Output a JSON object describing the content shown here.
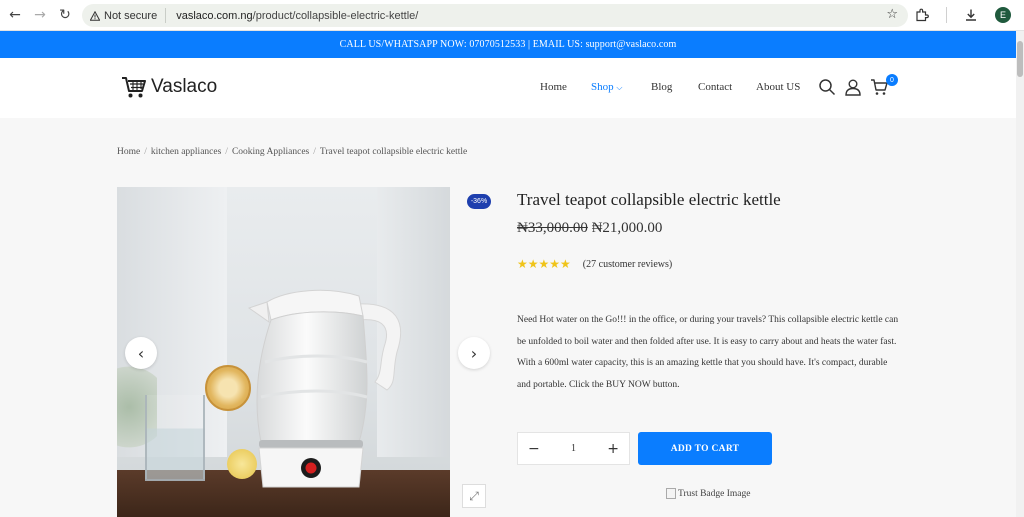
{
  "browser": {
    "back_icon": "arrow-left-icon",
    "forward_icon": "arrow-right-icon",
    "reload_icon": "reload-icon",
    "security_label": "Not secure",
    "url_domain": "vaslaco.com.ng",
    "url_path": "/product/collapsible-electric-kettle/",
    "bookmark_icon": "star-icon",
    "extensions_icon": "puzzle-icon",
    "download_icon": "download-icon",
    "profile_initial": "E",
    "menu_icon": "vertical-dots-icon"
  },
  "topbar": {
    "text": "CALL US/WHATSAPP NOW: 07070512533 | EMAIL US: support@vaslaco.com"
  },
  "header": {
    "logo_text": "Vaslaco",
    "menu": {
      "home": "Home",
      "shop": "Shop",
      "blog": "Blog",
      "contact": "Contact",
      "about": "About US"
    },
    "cart_count": "0"
  },
  "breadcrumb": {
    "home": "Home",
    "cat1": "kitchen appliances",
    "cat2": "Cooking Appliances",
    "current": "Travel teapot collapsible electric kettle",
    "separator": "/"
  },
  "product": {
    "sale_badge": "-36%",
    "title": "Travel teapot collapsible electric kettle",
    "old_price": "₦33,000.00",
    "new_price": "₦21,000.00",
    "stars": "★★★★★",
    "rating": 5,
    "reviews": "(27 customer reviews)",
    "description": "Need Hot water on the Go!!! in the office, or during your travels? This collapsible electric kettle can be unfolded to boil water and then folded after use. It is easy to carry about and heats the water fast. With a 600ml water capacity, this is an amazing kettle that you should have. It's compact, durable and portable. Click the BUY NOW button.",
    "quantity": "1",
    "add_to_cart": "ADD TO CART",
    "trust_badge_alt": "Trust Badge Image"
  },
  "colors": {
    "accent": "#0a7dff",
    "badge": "#1e3fae",
    "star": "#f0c419"
  }
}
